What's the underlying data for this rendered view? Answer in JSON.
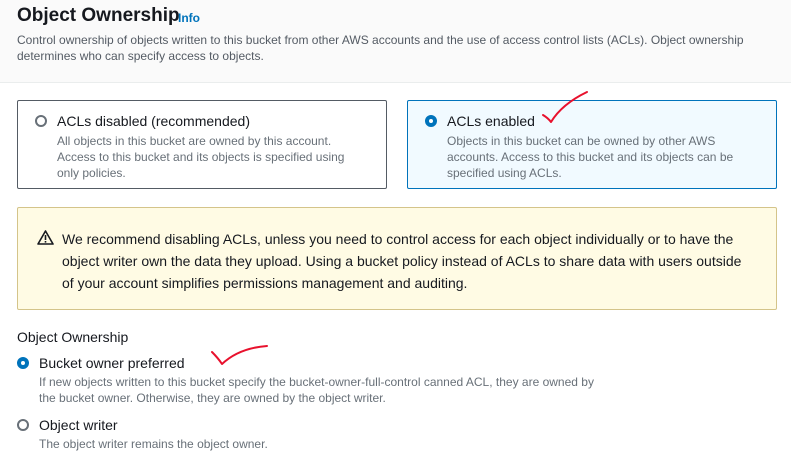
{
  "section": {
    "title": "Object Ownership",
    "info_link": "Info",
    "description": "Control ownership of objects written to this bucket from other AWS accounts and the use of access control lists (ACLs). Object ownership determines who can specify access to objects."
  },
  "acl_tiles": [
    {
      "label": "ACLs disabled (recommended)",
      "description": "All objects in this bucket are owned by this account. Access to this bucket and its objects is specified using only policies.",
      "selected": false
    },
    {
      "label": "ACLs enabled",
      "description": "Objects in this bucket can be owned by other AWS accounts. Access to this bucket and its objects can be specified using ACLs.",
      "selected": true
    }
  ],
  "warning": {
    "icon": "warning-triangle-icon",
    "text": "We recommend disabling ACLs, unless you need to control access for each object individually or to have the object writer own the data they upload. Using a bucket policy instead of ACLs to share data with users outside of your account simplifies permissions management and auditing."
  },
  "ownership": {
    "label": "Object Ownership",
    "options": [
      {
        "label": "Bucket owner preferred",
        "description": "If new objects written to this bucket specify the bucket-owner-full-control canned ACL, they are owned by the bucket owner. Otherwise, they are owned by the object writer.",
        "selected": true
      },
      {
        "label": "Object writer",
        "description": "The object writer remains the object owner.",
        "selected": false
      }
    ]
  },
  "colors": {
    "accent": "#0073bb",
    "warning_bg": "#fffbe4",
    "annotation_red": "#e8112d"
  }
}
